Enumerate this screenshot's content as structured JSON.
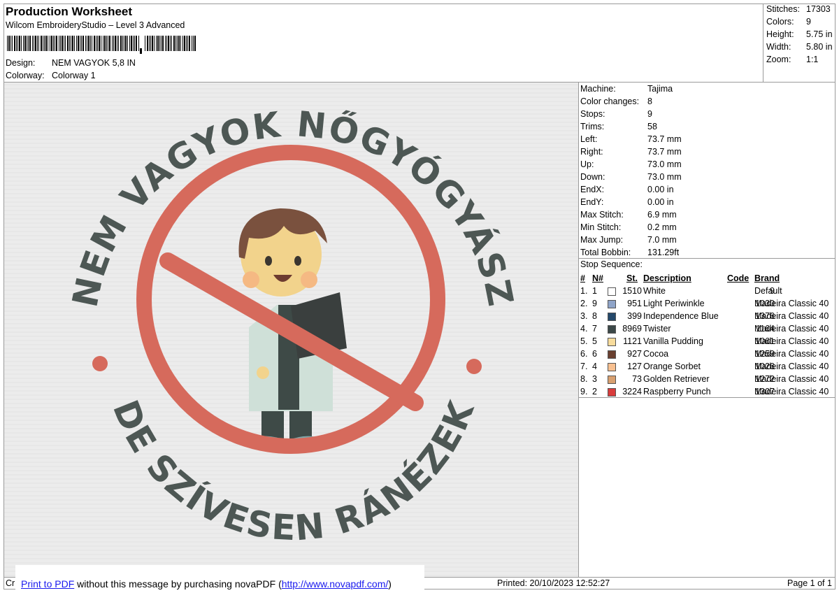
{
  "header": {
    "title": "Production Worksheet",
    "software": "Wilcom EmbroideryStudio – Level 3 Advanced",
    "design_label": "Design:",
    "design_value": "NEM VAGYOK 5,8 IN",
    "colorway_label": "Colorway:",
    "colorway_value": "Colorway 1"
  },
  "stats": [
    {
      "label": "Stitches:",
      "value": "17303"
    },
    {
      "label": "Colors:",
      "value": "9"
    },
    {
      "label": "Height:",
      "value": "5.75 in"
    },
    {
      "label": "Width:",
      "value": "5.80 in"
    },
    {
      "label": "Zoom:",
      "value": "1:1"
    }
  ],
  "machine_info": [
    {
      "label": "Machine:",
      "value": "Tajima"
    },
    {
      "label": "Color changes:",
      "value": "8"
    },
    {
      "label": "Stops:",
      "value": "9"
    },
    {
      "label": "Trims:",
      "value": "58"
    },
    {
      "label": "Left:",
      "value": "73.7 mm"
    },
    {
      "label": "Right:",
      "value": "73.7 mm"
    },
    {
      "label": "Up:",
      "value": "73.0 mm"
    },
    {
      "label": "Down:",
      "value": "73.0 mm"
    },
    {
      "label": "EndX:",
      "value": "0.00 in"
    },
    {
      "label": "EndY:",
      "value": "0.00 in"
    },
    {
      "label": "Max Stitch:",
      "value": "6.9 mm"
    },
    {
      "label": "Min Stitch:",
      "value": "0.2 mm"
    },
    {
      "label": "Max Jump:",
      "value": "7.0 mm"
    },
    {
      "label": "Total Bobbin:",
      "value": "131.29ft"
    }
  ],
  "stop_sequence": {
    "title": "Stop Sequence:",
    "headers": {
      "idx": "#",
      "n": "N#",
      "st": "St.",
      "desc": "Description",
      "code": "Code",
      "brand": "Brand"
    },
    "rows": [
      {
        "idx": "1.",
        "n": "1",
        "color": "#ffffff",
        "st": "1510",
        "desc": "White",
        "code": "9",
        "brand": "Default"
      },
      {
        "idx": "2.",
        "n": "9",
        "color": "#8fa4c8",
        "st": "951",
        "desc": "Light Periwinkle",
        "code": "1030",
        "brand": "Madeira Classic 40"
      },
      {
        "idx": "3.",
        "n": "8",
        "color": "#24486a",
        "st": "399",
        "desc": "Independence Blue",
        "code": "1376",
        "brand": "Madeira Classic 40"
      },
      {
        "idx": "4.",
        "n": "7",
        "color": "#3c4848",
        "st": "8969",
        "desc": "Twister",
        "code": "1164",
        "brand": "Madeira Classic 40"
      },
      {
        "idx": "5.",
        "n": "5",
        "color": "#f8dc9c",
        "st": "1121",
        "desc": "Vanilla Pudding",
        "code": "1061",
        "brand": "Madeira Classic 40"
      },
      {
        "idx": "6.",
        "n": "6",
        "color": "#6a4030",
        "st": "927",
        "desc": "Cocoa",
        "code": "1259",
        "brand": "Madeira Classic 40"
      },
      {
        "idx": "7.",
        "n": "4",
        "color": "#f8c090",
        "st": "127",
        "desc": "Orange Sorbet",
        "code": "1026",
        "brand": "Madeira Classic 40"
      },
      {
        "idx": "8.",
        "n": "3",
        "color": "#d8a070",
        "st": "73",
        "desc": "Golden Retriever",
        "code": "1272",
        "brand": "Madeira Classic 40"
      },
      {
        "idx": "9.",
        "n": "2",
        "color": "#d83c3c",
        "st": "3224",
        "desc": "Raspberry Punch",
        "code": "1307",
        "brand": "Madeira Classic 40"
      }
    ]
  },
  "design_preview": {
    "top_text": "NEM VAGYOK NŐGYÓGYÁSZ",
    "bottom_text": "DE SZÍVESEN RÁNÉZEK",
    "text_color": "#4d5754",
    "ring_color": "#d66a5c"
  },
  "footer": {
    "left_fragment": "Cr",
    "pdf_link": "Print to PDF",
    "pdf_middle": " without this message by purchasing novaPDF (",
    "pdf_url": "http://www.novapdf.com/",
    "pdf_end": ")",
    "printed": "Printed: 20/10/2023 12:52:27",
    "page": "Page 1 of 1"
  }
}
